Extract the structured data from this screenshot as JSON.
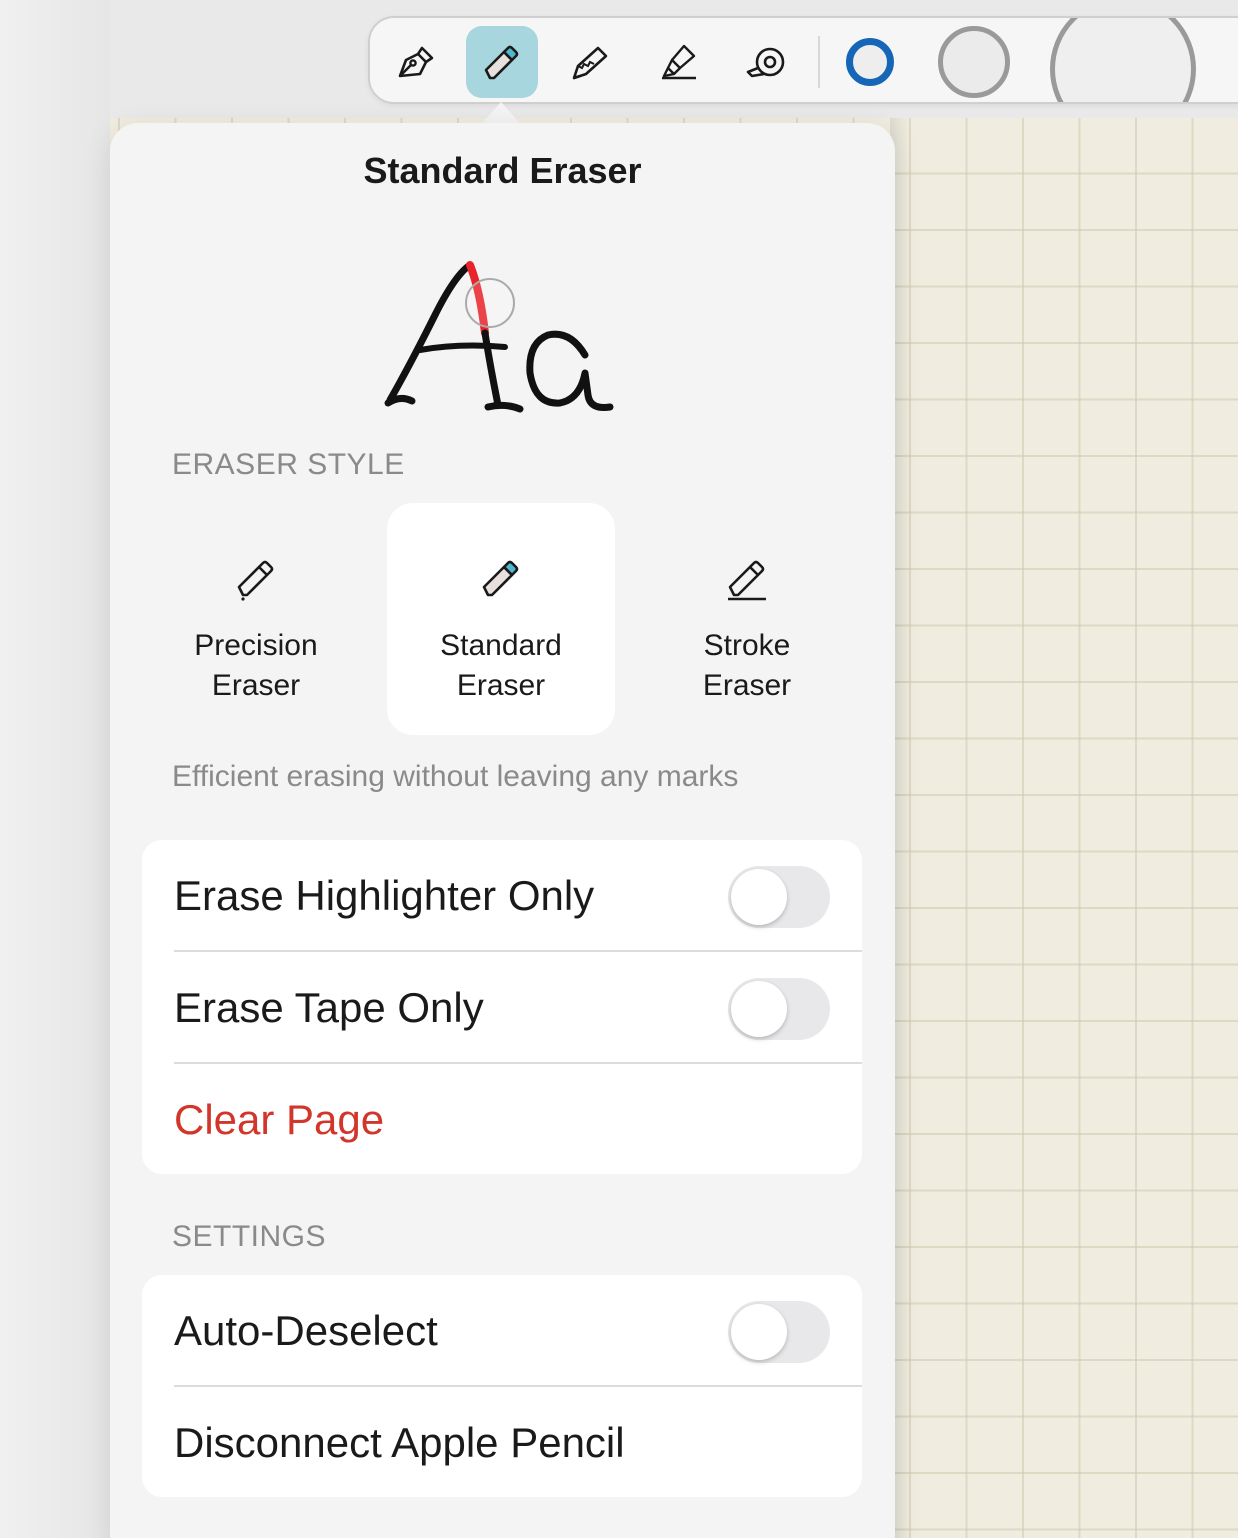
{
  "toolbar": {
    "tools": [
      {
        "name": "pen-tool",
        "active": false
      },
      {
        "name": "eraser-tool",
        "active": true
      },
      {
        "name": "pencil-tool",
        "active": false
      },
      {
        "name": "highlighter-tool",
        "active": false
      },
      {
        "name": "tape-tool",
        "active": false
      }
    ],
    "selected_color": "#1666b8",
    "active_color": "#a8d6de"
  },
  "popover": {
    "title": "Standard Eraser",
    "eraser_style_label": "ERASER STYLE",
    "styles": [
      {
        "label": "Precision\nEraser",
        "selected": false,
        "icon": "precision-eraser-icon"
      },
      {
        "label": "Standard\nEraser",
        "selected": true,
        "icon": "standard-eraser-icon"
      },
      {
        "label": "Stroke\nEraser",
        "selected": false,
        "icon": "stroke-eraser-icon"
      }
    ],
    "description": "Efficient erasing without leaving any marks",
    "options": [
      {
        "label": "Erase Highlighter Only",
        "toggle": false
      },
      {
        "label": "Erase Tape Only",
        "toggle": false
      }
    ],
    "clear_page": "Clear Page",
    "clear_color": "#d2362b",
    "settings_label": "SETTINGS",
    "settings": [
      {
        "label": "Auto-Deselect",
        "toggle": false
      },
      {
        "label": "Disconnect Apple Pencil"
      }
    ]
  }
}
